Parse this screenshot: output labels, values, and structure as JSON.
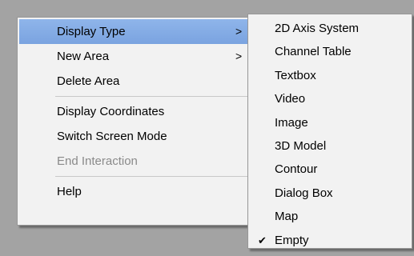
{
  "main_menu": {
    "items": [
      {
        "label": "Display Type",
        "arrow": ">"
      },
      {
        "label": "New Area",
        "arrow": ">"
      },
      {
        "label": "Delete Area"
      },
      {
        "label": "Display Coordinates"
      },
      {
        "label": "Switch Screen Mode"
      },
      {
        "label": "End Interaction"
      },
      {
        "label": "Help"
      }
    ]
  },
  "sub_menu": {
    "items": [
      {
        "label": "2D Axis System"
      },
      {
        "label": "Channel Table"
      },
      {
        "label": "Textbox"
      },
      {
        "label": "Video"
      },
      {
        "label": "Image"
      },
      {
        "label": "3D Model"
      },
      {
        "label": "Contour"
      },
      {
        "label": "Dialog Box"
      },
      {
        "label": "Map"
      },
      {
        "label": "Empty",
        "check": "✔"
      }
    ]
  },
  "colors": {
    "highlight": "#7aa3e0",
    "disabled_text": "#8a8a8a"
  }
}
